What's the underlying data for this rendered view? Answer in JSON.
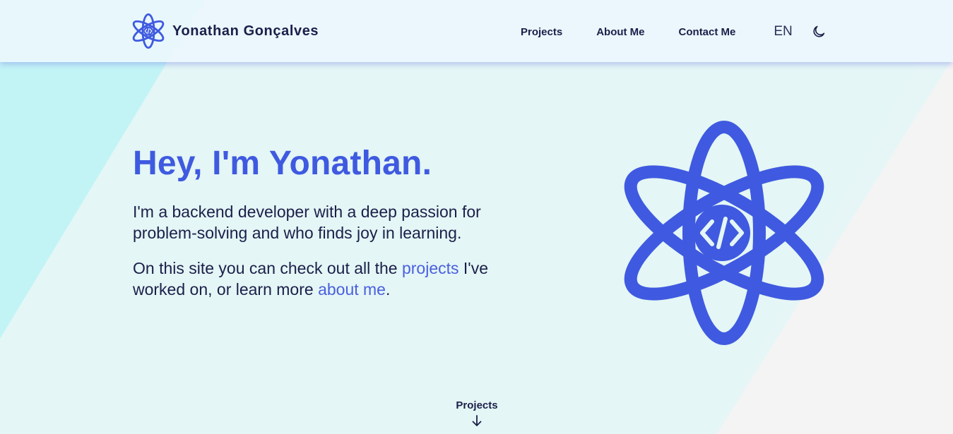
{
  "header": {
    "brand_name": "Yonathan Gonçalves",
    "nav": {
      "projects": "Projects",
      "about": "About Me",
      "contact": "Contact Me"
    },
    "language": "EN"
  },
  "hero": {
    "title": "Hey, I'm Yonathan.",
    "intro": "I'm a backend developer with a deep passion for problem-solving and who finds joy in learning.",
    "more_prefix": "On this site you can check out all the ",
    "projects_link": "projects",
    "more_middle": " I've worked on, or learn more ",
    "about_link": "about me",
    "more_suffix": "."
  },
  "scroll_cue": {
    "label": "Projects"
  },
  "colors": {
    "accent": "#3f5ae0",
    "text": "#1b1f4a",
    "bg_cyan": "#c2f4f6",
    "bg_mint": "#e4f6f5",
    "bg_light": "#f4f4f4"
  },
  "icons": {
    "logo": "atom-code-icon",
    "theme": "moon-icon",
    "scroll": "arrow-down-icon"
  }
}
